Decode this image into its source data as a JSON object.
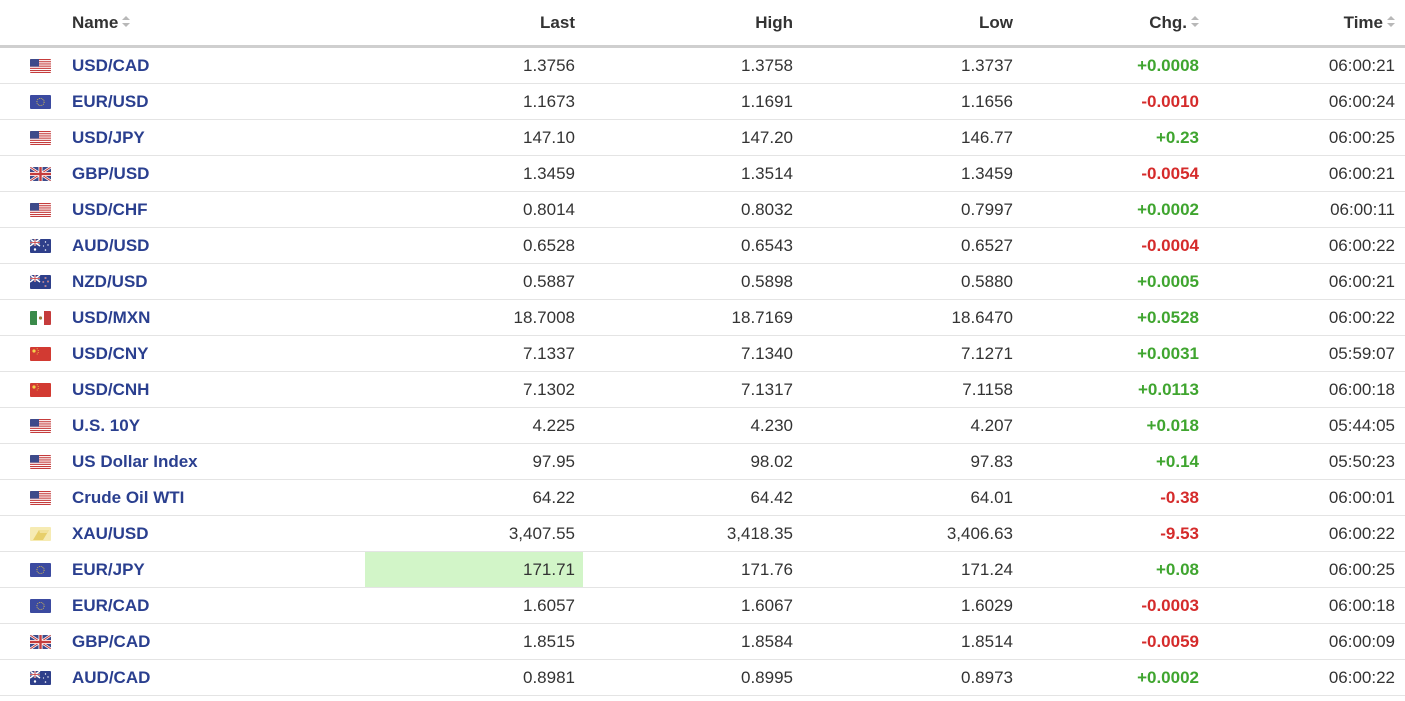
{
  "header": {
    "name": "Name",
    "last": "Last",
    "high": "High",
    "low": "Low",
    "chg": "Chg.",
    "time": "Time"
  },
  "colors": {
    "positive": "#3fa52f",
    "negative": "#d52b2b",
    "link": "#2a3f8f",
    "highlight": "#d2f5c8"
  },
  "rows": [
    {
      "flag": "us-flag-icon",
      "name": "USD/CAD",
      "last": "1.3756",
      "high": "1.3758",
      "low": "1.3737",
      "chg": "+0.0008",
      "dir": "pos",
      "time": "06:00:21"
    },
    {
      "flag": "eu-flag-icon",
      "name": "EUR/USD",
      "last": "1.1673",
      "high": "1.1691",
      "low": "1.1656",
      "chg": "-0.0010",
      "dir": "neg",
      "time": "06:00:24"
    },
    {
      "flag": "us-flag-icon",
      "name": "USD/JPY",
      "last": "147.10",
      "high": "147.20",
      "low": "146.77",
      "chg": "+0.23",
      "dir": "pos",
      "time": "06:00:25"
    },
    {
      "flag": "uk-flag-icon",
      "name": "GBP/USD",
      "last": "1.3459",
      "high": "1.3514",
      "low": "1.3459",
      "chg": "-0.0054",
      "dir": "neg",
      "time": "06:00:21"
    },
    {
      "flag": "us-flag-icon",
      "name": "USD/CHF",
      "last": "0.8014",
      "high": "0.8032",
      "low": "0.7997",
      "chg": "+0.0002",
      "dir": "pos",
      "time": "06:00:11"
    },
    {
      "flag": "au-flag-icon",
      "name": "AUD/USD",
      "last": "0.6528",
      "high": "0.6543",
      "low": "0.6527",
      "chg": "-0.0004",
      "dir": "neg",
      "time": "06:00:22"
    },
    {
      "flag": "nz-flag-icon",
      "name": "NZD/USD",
      "last": "0.5887",
      "high": "0.5898",
      "low": "0.5880",
      "chg": "+0.0005",
      "dir": "pos",
      "time": "06:00:21"
    },
    {
      "flag": "mx-flag-icon",
      "name": "USD/MXN",
      "last": "18.7008",
      "high": "18.7169",
      "low": "18.6470",
      "chg": "+0.0528",
      "dir": "pos",
      "time": "06:00:22"
    },
    {
      "flag": "cn-flag-icon",
      "name": "USD/CNY",
      "last": "7.1337",
      "high": "7.1340",
      "low": "7.1271",
      "chg": "+0.0031",
      "dir": "pos",
      "time": "05:59:07"
    },
    {
      "flag": "cn-flag-icon",
      "name": "USD/CNH",
      "last": "7.1302",
      "high": "7.1317",
      "low": "7.1158",
      "chg": "+0.0113",
      "dir": "pos",
      "time": "06:00:18"
    },
    {
      "flag": "us-flag-icon",
      "name": "U.S. 10Y",
      "last": "4.225",
      "high": "4.230",
      "low": "4.207",
      "chg": "+0.018",
      "dir": "pos",
      "time": "05:44:05"
    },
    {
      "flag": "us-flag-icon",
      "name": "US Dollar Index",
      "last": "97.95",
      "high": "98.02",
      "low": "97.83",
      "chg": "+0.14",
      "dir": "pos",
      "time": "05:50:23"
    },
    {
      "flag": "us-flag-icon",
      "name": "Crude Oil WTI",
      "last": "64.22",
      "high": "64.42",
      "low": "64.01",
      "chg": "-0.38",
      "dir": "neg",
      "time": "06:00:01"
    },
    {
      "flag": "gold-icon",
      "name": "XAU/USD",
      "last": "3,407.55",
      "high": "3,418.35",
      "low": "3,406.63",
      "chg": "-9.53",
      "dir": "neg",
      "time": "06:00:22"
    },
    {
      "flag": "eu-flag-icon",
      "name": "EUR/JPY",
      "last": "171.71",
      "high": "171.76",
      "low": "171.24",
      "chg": "+0.08",
      "dir": "pos",
      "time": "06:00:25",
      "last_highlight": true
    },
    {
      "flag": "eu-flag-icon",
      "name": "EUR/CAD",
      "last": "1.6057",
      "high": "1.6067",
      "low": "1.6029",
      "chg": "-0.0003",
      "dir": "neg",
      "time": "06:00:18"
    },
    {
      "flag": "uk-flag-icon",
      "name": "GBP/CAD",
      "last": "1.8515",
      "high": "1.8584",
      "low": "1.8514",
      "chg": "-0.0059",
      "dir": "neg",
      "time": "06:00:09"
    },
    {
      "flag": "au-flag-icon",
      "name": "AUD/CAD",
      "last": "0.8981",
      "high": "0.8995",
      "low": "0.8973",
      "chg": "+0.0002",
      "dir": "pos",
      "time": "06:00:22"
    }
  ]
}
